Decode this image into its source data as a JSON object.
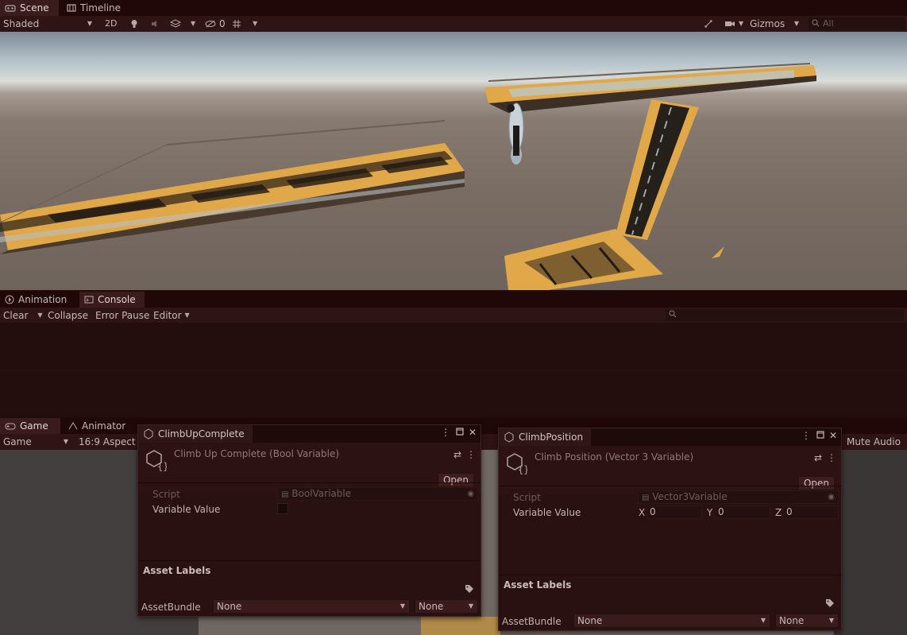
{
  "top_tabs": [
    {
      "label": "Scene",
      "icon": "scene-icon"
    },
    {
      "label": "Timeline",
      "icon": "timeline-icon"
    }
  ],
  "scene_toolbar": {
    "draw_mode": "Shaded",
    "mode_2d": "2D",
    "hidden_count": "0",
    "gizmos": "Gizmos",
    "search_placeholder": "All"
  },
  "mid_tabs": [
    {
      "label": "Animation",
      "icon": "animation-icon"
    },
    {
      "label": "Console",
      "icon": "console-icon"
    }
  ],
  "console_toolbar": {
    "clear": "Clear",
    "collapse": "Collapse",
    "error_pause": "Error Pause",
    "editor": "Editor"
  },
  "bottom_tabs": [
    {
      "label": "Game",
      "icon": "game-icon"
    },
    {
      "label": "Animator",
      "icon": "animator-icon"
    }
  ],
  "game_toolbar": {
    "display": "Game",
    "aspect": "16:9 Aspect",
    "mute_audio": "Mute Audio"
  },
  "inspector_left": {
    "tab_label": "ClimbUpComplete",
    "title": "Climb Up Complete (Bool Variable)",
    "open_label": "Open",
    "script_label": "Script",
    "script_value": "BoolVariable",
    "value_label": "Variable Value",
    "value_checked": false,
    "asset_labels": "Asset Labels",
    "assetbundle_label": "AssetBundle",
    "bundle_name": "None",
    "bundle_variant": "None"
  },
  "inspector_right": {
    "tab_label": "ClimbPosition",
    "title": "Climb Position (Vector 3 Variable)",
    "open_label": "Open",
    "script_label": "Script",
    "script_value": "Vector3Variable",
    "value_label": "Variable Value",
    "x_label": "X",
    "x_value": "0",
    "y_label": "Y",
    "y_value": "0",
    "z_label": "Z",
    "z_value": "0",
    "asset_labels": "Asset Labels",
    "assetbundle_label": "AssetBundle",
    "bundle_name": "None",
    "bundle_variant": "None"
  },
  "colors": {
    "editor_tint": "#2e1414",
    "platform_orange": "#e0a848",
    "sky": "#d9dcd9",
    "ground": "#796d64"
  }
}
